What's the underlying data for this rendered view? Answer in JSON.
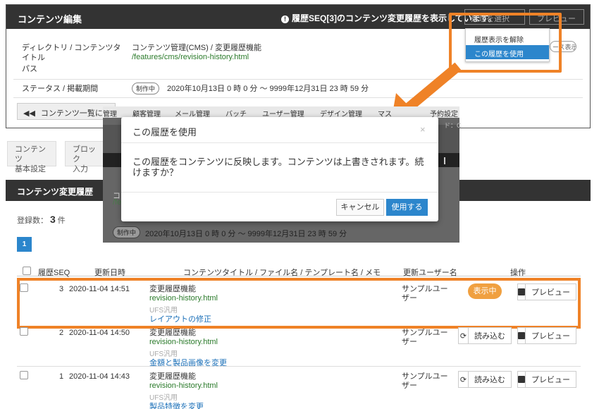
{
  "edit_panel": {
    "title": "コンテンツ編集",
    "revision_notice": "履歴SEQ[3]のコンテンツ変更履歴を表示しています。",
    "select_history_btn": "処理を選択",
    "preview_btn": "プレビュー",
    "labels": {
      "directory_title": "ディレクトリ / コンテンツタイトル",
      "path": "パス",
      "status_period": "ステータス / 掲載期間"
    },
    "directory_value": "コンテンツ管理(CMS) / 変更履歴機能",
    "path_value": "/features/cms/revision-history.html",
    "status_badge": "制作中",
    "period": "2020年10月13日 0 時 0 分 〜 9999年12月31日 23 時 59 分",
    "back_button": "コンテンツ一覧に戻る",
    "ghost_right_btn": "ース表示"
  },
  "dropdown": {
    "items": [
      "履歴表示を解除",
      "この履歴を使用"
    ]
  },
  "nav_menu": [
    "管理",
    "顧客管理",
    "メール管理",
    "バッチ",
    "ユーザー管理",
    "デザイン管理",
    "マス",
    "予約設定"
  ],
  "side_tabs": [
    {
      "label": "コンテンツ\n基本設定"
    },
    {
      "label": "ブロック\n入力"
    }
  ],
  "history": {
    "title": "コンテンツ変更履歴",
    "count_prefix": "登録数：",
    "count": "3",
    "count_suffix": "件",
    "page": "1",
    "columns": [
      "履歴SEQ",
      "更新日時",
      "コンテンツタイトル / ファイル名 / テンプレート名 / メモ",
      "更新ユーザー名",
      "操作"
    ],
    "rows": [
      {
        "seq": "3",
        "date": "2020-11-04 14:51",
        "title": "変更履歴機能",
        "file": "revision-history.html",
        "template": "UFS汎用",
        "memo": "レイアウトの修正",
        "user": "サンプルユーザー",
        "action": "表示中",
        "preview": "プレビュー"
      },
      {
        "seq": "2",
        "date": "2020-11-04 14:50",
        "title": "変更履歴機能",
        "file": "revision-history.html",
        "template": "UFS汎用",
        "memo": "金額と製品画像を変更",
        "user": "サンプルユーザー",
        "action": "読み込む",
        "preview": "プレビュー"
      },
      {
        "seq": "1",
        "date": "2020-11-04 14:43",
        "title": "変更履歴機能",
        "file": "revision-history.html",
        "template": "UFS汎用",
        "memo": "製品特徴を変更",
        "user": "サンプルユーザー",
        "action": "読み込む",
        "preview": "プレビュー"
      }
    ]
  },
  "dim_overlay": {
    "header_title": "ド：C",
    "snippet_title": "コ",
    "snippet_path": "/fe",
    "status_badge": "制作中",
    "period": "2020年10月13日 0 時 0 分 〜 9999年12月31日 23 時 59 分"
  },
  "modal": {
    "title": "この履歴を使用",
    "close": "×",
    "body": "この履歴をコンテンツに反映します。コンテンツは上書きされます。続けますか？",
    "cancel": "キャンセル",
    "confirm": "使用する"
  },
  "colors": {
    "header_bg": "#333333",
    "primary_blue": "#2c86cc",
    "highlight_orange": "#ef8227",
    "active_badge": "#f0a040",
    "link_green": "#2a7a2a"
  }
}
